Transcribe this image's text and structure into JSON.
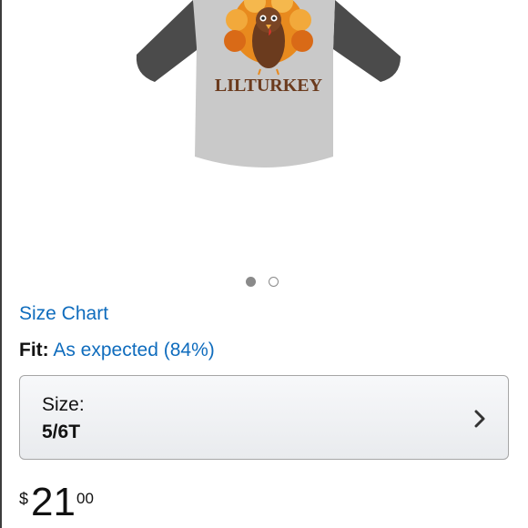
{
  "product": {
    "image": {
      "print_text": "LILTURKEY"
    }
  },
  "carousel": {
    "count": 2,
    "active_index": 0
  },
  "size_chart": {
    "label": "Size Chart"
  },
  "fit": {
    "label": "Fit:",
    "value": "As expected (84%)"
  },
  "size_selector": {
    "label": "Size:",
    "value": "5/6T"
  },
  "price": {
    "currency": "$",
    "whole": "21",
    "fraction": "00"
  },
  "colors": {
    "link": "#0f6cbd",
    "shirt_body": "#c9c9c9",
    "shirt_sleeves": "#4b4b4b",
    "turkey_brown": "#6b3b1e",
    "feather_orange": "#e88a1e"
  }
}
